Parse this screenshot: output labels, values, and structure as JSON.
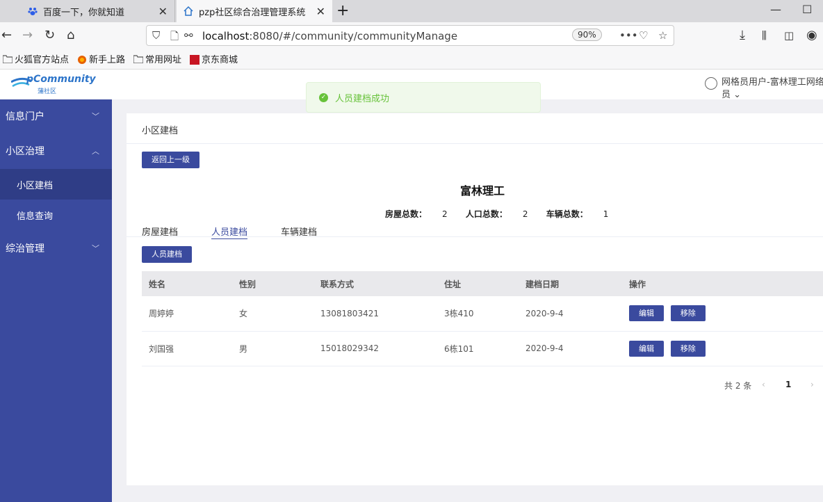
{
  "browser": {
    "tabs": [
      {
        "label": "百度一下，你就知道"
      },
      {
        "label": "pzp社区综合治理管理系统"
      }
    ],
    "url_host": "localhost",
    "url_rest": ":8080/#/community/communityManage",
    "zoom": "90%",
    "bookmarks": [
      "火狐官方站点",
      "新手上路",
      "常用网址",
      "京东商城"
    ]
  },
  "app": {
    "logo_text": "pCommunity",
    "logo_sub": "蒲社区",
    "toast": "人员建档成功",
    "user": "网格员用户-富林理工网络员"
  },
  "sidebar": {
    "items": [
      {
        "label": "信息门户"
      },
      {
        "label": "小区治理"
      },
      {
        "label": "小区建档"
      },
      {
        "label": "信息查询"
      },
      {
        "label": "综治管理"
      }
    ]
  },
  "main": {
    "card_title": "小区建档",
    "back_button": "返回上一级",
    "place_title": "富林理工",
    "stats": {
      "house_label": "房屋总数：",
      "house_value": "2",
      "people_label": "人口总数：",
      "people_value": "2",
      "vehicle_label": "车辆总数：",
      "vehicle_value": "1"
    },
    "tabs": [
      "房屋建档",
      "人员建档",
      "车辆建档"
    ],
    "add_button": "人员建档",
    "table": {
      "headers": [
        "姓名",
        "性别",
        "联系方式",
        "住址",
        "建档日期",
        "操作"
      ],
      "rows": [
        {
          "name": "周婷婷",
          "gender": "女",
          "phone": "13081803421",
          "address": "3栋410",
          "date": "2020-9-4",
          "edit": "编辑",
          "remove": "移除"
        },
        {
          "name": "刘国强",
          "gender": "男",
          "phone": "15018029342",
          "address": "6栋101",
          "date": "2020-9-4",
          "edit": "编辑",
          "remove": "移除"
        }
      ]
    },
    "pager": {
      "total": "共 2 条",
      "prev": "‹",
      "page": "1",
      "next": "›"
    }
  },
  "colors": {
    "primary": "#3a4a9e",
    "success": "#67c23a"
  }
}
